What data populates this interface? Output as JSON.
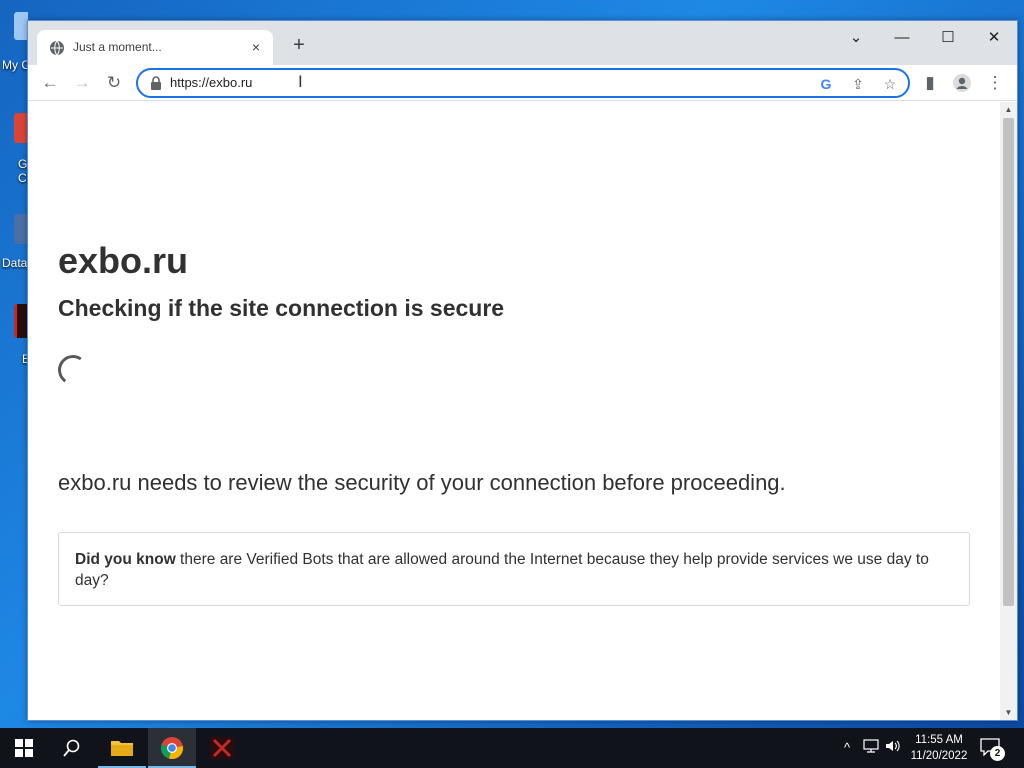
{
  "desktop": {
    "icons": [
      {
        "label": "My C",
        "color": "#f4c842"
      },
      {
        "label": "G\nCl",
        "color": "#db4437"
      },
      {
        "label": "Data",
        "color": "#4a6fa5"
      },
      {
        "label": "E",
        "color": "#c62828"
      }
    ]
  },
  "browser": {
    "tab": {
      "title": "Just a moment...",
      "close": "×"
    },
    "new_tab": "+",
    "window_controls": {
      "tab_search": "⌄",
      "minimize": "—",
      "maximize": "☐",
      "close": "✕"
    },
    "nav": {
      "back": "←",
      "forward": "→",
      "reload": "↻"
    },
    "omnibox": {
      "url": "https://exbo.ru"
    },
    "toolbar_right": {
      "google": "G",
      "share": "⇪",
      "bookmark": "☆",
      "sidepanel": "▮",
      "profile": "●",
      "menu": "⋮"
    }
  },
  "page": {
    "site_name": "exbo.ru",
    "subtitle": "Checking if the site connection is secure",
    "review_text": "exbo.ru needs to review the security of your connection before proceeding.",
    "info_bold": "Did you know",
    "info_text": " there are Verified Bots that are allowed around the Internet because they help provide services we use day to day?"
  },
  "taskbar": {
    "clock_time": "11:55 AM",
    "clock_date": "11/20/2022",
    "notification_count": "2",
    "tray": {
      "chevron": "^",
      "network": "🖧",
      "volume": "🔊"
    }
  },
  "colors": {
    "accent": "#1a73e8",
    "page_text": "#313131",
    "taskbar": "#101319"
  }
}
